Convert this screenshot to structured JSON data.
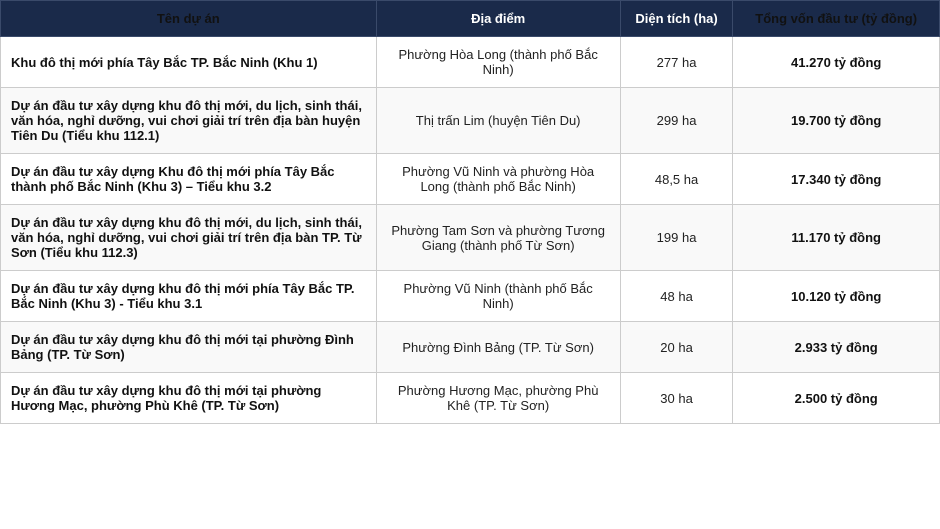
{
  "table": {
    "headers": {
      "name": "Tên dự án",
      "location": "Địa điểm",
      "area": "Diện tích (ha)",
      "capital": "Tổng vốn đầu tư (tỷ đồng)"
    },
    "rows": [
      {
        "name": "Khu đô thị mới phía Tây Bắc TP. Bắc Ninh (Khu 1)",
        "location": "Phường Hòa Long (thành phố Bắc Ninh)",
        "area": "277 ha",
        "capital": "41.270 tỷ đồng"
      },
      {
        "name": "Dự án đầu tư xây dựng khu đô thị mới, du lịch, sinh thái, văn hóa, nghỉ dưỡng, vui chơi giải trí trên địa bàn huyện Tiên Du (Tiểu khu 112.1)",
        "location": "Thị trấn Lim (huyện Tiên Du)",
        "area": "299 ha",
        "capital": "19.700 tỷ đồng"
      },
      {
        "name": "Dự án đầu tư xây dựng Khu đô thị mới phía Tây Bắc thành phố Bắc Ninh (Khu 3) – Tiểu khu 3.2",
        "location": "Phường Vũ Ninh và phường Hòa Long (thành phố Bắc Ninh)",
        "area": "48,5 ha",
        "capital": "17.340 tỷ đồng"
      },
      {
        "name": "Dự án đầu tư xây dựng khu đô thị mới, du lịch, sinh thái, văn hóa, nghỉ dưỡng, vui chơi giải trí trên địa bàn TP. Từ Sơn (Tiểu khu 112.3)",
        "location": "Phường Tam Sơn và phường Tương Giang (thành phố Từ Sơn)",
        "area": "199 ha",
        "capital": "11.170 tỷ đồng"
      },
      {
        "name": "Dự án đầu tư xây dựng khu đô thị mới phía Tây Bắc TP. Bắc Ninh (Khu 3) - Tiểu khu 3.1",
        "location": "Phường Vũ Ninh (thành phố Bắc Ninh)",
        "area": "48 ha",
        "capital": "10.120 tỷ đồng"
      },
      {
        "name": "Dự án đầu tư xây dựng khu đô thị mới tại phường Đình Bảng (TP. Từ Sơn)",
        "location": "Phường Đình Bảng (TP. Từ Sơn)",
        "area": "20 ha",
        "capital": "2.933 tỷ đồng"
      },
      {
        "name": "Dự án đầu tư xây dựng khu đô thị mới tại phường Hương Mạc, phường Phù Khê (TP. Từ Sơn)",
        "location": "Phường Hương Mạc, phường Phù Khê (TP. Từ Sơn)",
        "area": "30 ha",
        "capital": "2.500 tỷ đồng"
      }
    ]
  }
}
